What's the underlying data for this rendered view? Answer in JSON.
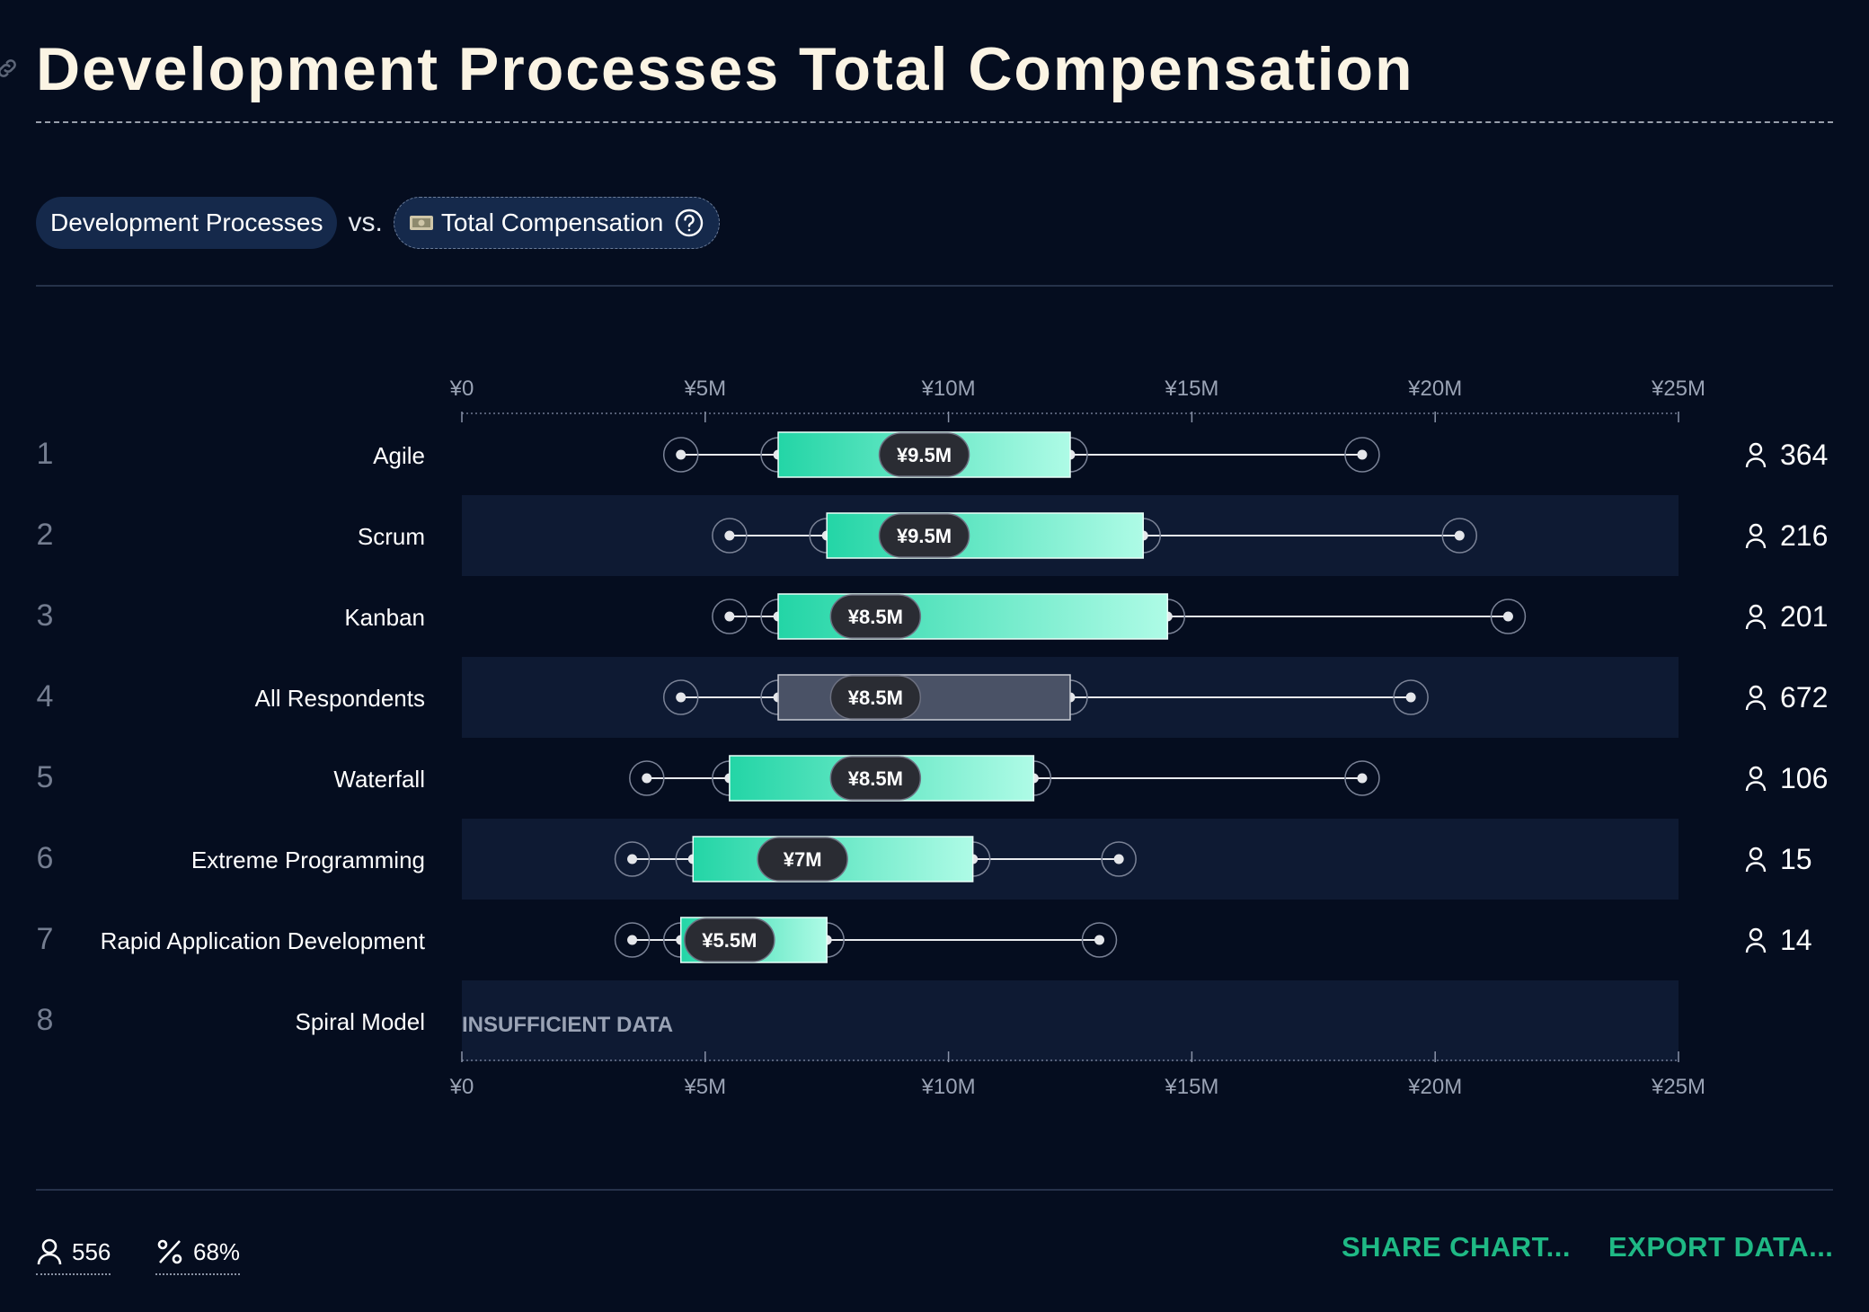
{
  "header": {
    "title": "Development Processes Total Compensation"
  },
  "filters": {
    "primary_label": "Development Processes",
    "vs_label": "vs.",
    "metric_label": "Total Compensation",
    "metric_icon": "money-icon",
    "help_icon": "help-icon"
  },
  "chart_data": {
    "type": "box",
    "currency_prefix": "¥",
    "xlim": [
      0,
      25000000
    ],
    "ticks": [
      0,
      5000000,
      10000000,
      15000000,
      20000000,
      25000000
    ],
    "tick_labels": [
      "¥0",
      "¥5M",
      "¥10M",
      "¥15M",
      "¥20M",
      "¥25M"
    ],
    "rows": [
      {
        "rank": "1",
        "label": "Agile",
        "min": 4500000,
        "q1": 6500000,
        "median": 9500000,
        "median_label": "¥9.5M",
        "q3": 12500000,
        "max": 18500000,
        "count": "364",
        "highlight": false
      },
      {
        "rank": "2",
        "label": "Scrum",
        "min": 5500000,
        "q1": 7500000,
        "median": 9500000,
        "median_label": "¥9.5M",
        "q3": 14000000,
        "max": 20500000,
        "count": "216",
        "highlight": false
      },
      {
        "rank": "3",
        "label": "Kanban",
        "min": 5500000,
        "q1": 6500000,
        "median": 8500000,
        "median_label": "¥8.5M",
        "q3": 14500000,
        "max": 21500000,
        "count": "201",
        "highlight": false
      },
      {
        "rank": "4",
        "label": "All Respondents",
        "min": 4500000,
        "q1": 6500000,
        "median": 8500000,
        "median_label": "¥8.5M",
        "q3": 12500000,
        "max": 19500000,
        "count": "672",
        "highlight": true
      },
      {
        "rank": "5",
        "label": "Waterfall",
        "min": 3800000,
        "q1": 5500000,
        "median": 8500000,
        "median_label": "¥8.5M",
        "q3": 11750000,
        "max": 18500000,
        "count": "106",
        "highlight": false
      },
      {
        "rank": "6",
        "label": "Extreme Programming",
        "min": 3500000,
        "q1": 4750000,
        "median": 7000000,
        "median_label": "¥7M",
        "q3": 10500000,
        "max": 13500000,
        "count": "15",
        "highlight": false
      },
      {
        "rank": "7",
        "label": "Rapid Application Development",
        "min": 3500000,
        "q1": 4500000,
        "median": 5500000,
        "median_label": "¥5.5M",
        "q3": 7500000,
        "max": 13100000,
        "count": "14",
        "highlight": false
      },
      {
        "rank": "8",
        "label": "Spiral Model",
        "insufficient": true,
        "insufficient_label": "INSUFFICIENT DATA"
      }
    ]
  },
  "footer": {
    "respondents": "556",
    "percent": "68%",
    "share_label": "SHARE CHART...",
    "export_label": "EXPORT DATA..."
  },
  "colors": {
    "background": "#050d1f",
    "band": "#0e1a33",
    "box_start": "#23d5a6",
    "box_end": "#aefbe6",
    "accent": "#1fb985"
  }
}
